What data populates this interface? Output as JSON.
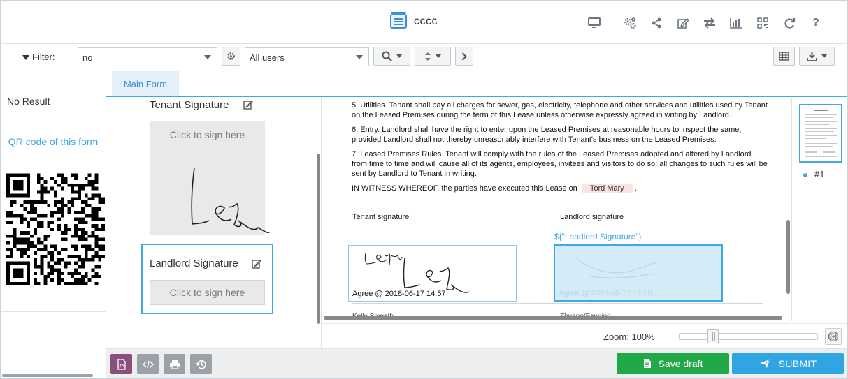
{
  "header": {
    "title": "cccc",
    "icons": [
      "monitor-icon",
      "settings-icon",
      "share-icon",
      "edit-icon",
      "transfer-icon",
      "chart-icon",
      "qr-icon",
      "refresh-icon",
      "help-icon"
    ]
  },
  "filterbar": {
    "filter_label": "Filter:",
    "filter_value": "no",
    "users_value": "All users"
  },
  "left": {
    "no_result": "No Result",
    "qr_link": "QR code of this form"
  },
  "tabs": [
    {
      "label": "Main Form",
      "active": true
    }
  ],
  "signatures": {
    "tenant_title": "Tenant Signature",
    "tenant_placeholder": "Click to sign here",
    "landlord_title": "Landlord Signature",
    "landlord_placeholder": "Click to sign here"
  },
  "document": {
    "para5": "5. Utilities. Tenant shall pay all charges for sewer, gas, electricity, telephone and other services and utilities used by Tenant on the Leased Premises during the term of this Lease unless otherwise expressly agreed in writing by Landlord.",
    "para6": "6. Entry. Landlord shall have the right to enter upon the Leased Premises at reasonable hours to inspect the same, provided Landlord shall not thereby unreasonably interfere with Tenant's business on the Leased Premises.",
    "para7": "7. Leased Premises Rules. Tenant will comply with the rules of the Leased Premises adopted and altered by Landlord from time to time and will cause all of its agents, employees, invitees and visitors to do so; all changes to such rules will be sent by Landlord to Tenant in writing.",
    "witness_prefix": "IN WITNESS WHEREOF, the parties have executed this Lease on",
    "witness_name": "Tord Mary",
    "witness_suffix": ".",
    "tenant_sig_label": "Tenant signature",
    "landlord_sig_label": "Landlord signature",
    "landlord_tag": "${\"Landlord Signature\"}",
    "tenant_agree": "Agree @ 2018-06-17 14:57",
    "landlord_agree": "Agree @ 2018-06-17 14:56",
    "cut_left": "Kelly Smeeth",
    "cut_right": "Zhuang/Fanning"
  },
  "thumbs": {
    "page_label": "#1"
  },
  "zoom": {
    "label": "Zoom: 100%",
    "level": 1.0
  },
  "actions": {
    "save_draft": "Save draft",
    "submit": "SUBMIT",
    "colors": {
      "pdf": "#8a4f7d",
      "gray": "#9ba1a6",
      "draft": "#20a849",
      "submit": "#2fa6e3"
    }
  }
}
